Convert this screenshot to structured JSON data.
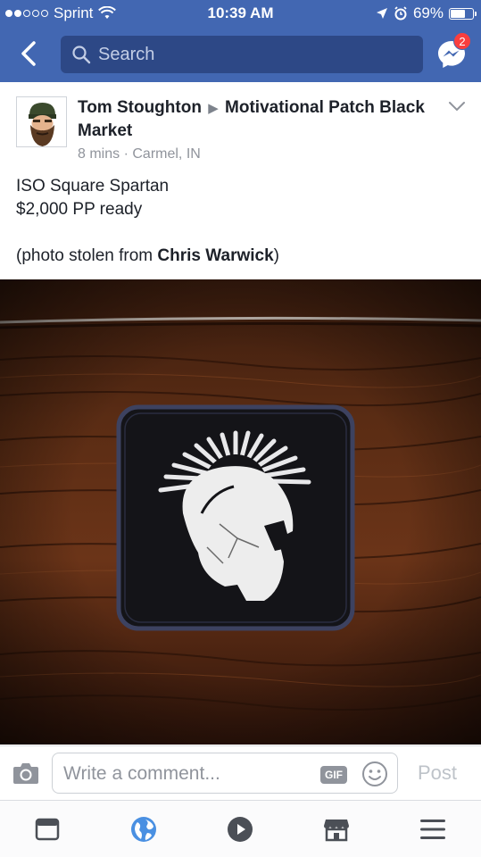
{
  "status_bar": {
    "carrier": "Sprint",
    "time": "10:39 AM",
    "battery_percent": "69%",
    "battery_level": 0.69,
    "signal_bars_filled": 2,
    "signal_bars_total": 5
  },
  "nav": {
    "search_placeholder": "Search",
    "messenger_badge": "2",
    "accent_color": "#4267b2"
  },
  "post": {
    "author": "Tom Stoughton",
    "group": "Motivational Patch Black Market",
    "time": "8 mins",
    "separator": "·",
    "location": "Carmel, IN",
    "lines": [
      "ISO Square Spartan",
      "$2,000 PP ready"
    ],
    "credit_prefix": "(photo stolen from ",
    "credit_name": "Chris Warwick",
    "credit_suffix": ")",
    "image_subject": "square black spartan helmet patch on wood"
  },
  "composer": {
    "placeholder": "Write a comment...",
    "gif_label": "GIF",
    "post_label": "Post"
  },
  "tabs": [
    {
      "icon": "news-feed-icon"
    },
    {
      "icon": "globe-icon"
    },
    {
      "icon": "video-icon"
    },
    {
      "icon": "marketplace-icon"
    },
    {
      "icon": "menu-icon"
    }
  ]
}
